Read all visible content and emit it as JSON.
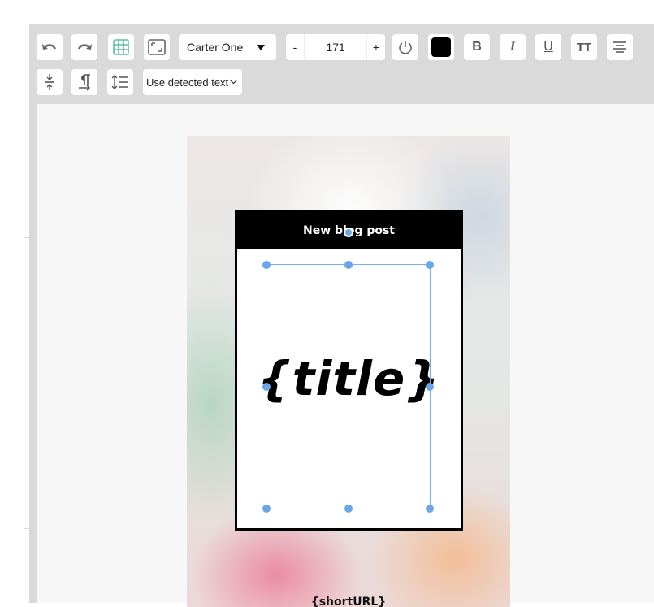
{
  "toolbar": {
    "font_family_value": "Carter One",
    "font_size_minus": "-",
    "font_size_value": "171",
    "font_size_plus": "+",
    "text_color": "#000000",
    "bold_label": "B",
    "italic_label": "I",
    "underline_label": "U",
    "text_case_label": "TT",
    "text_mode_value": "Use detected text"
  },
  "canvas": {
    "header_text": "New blog post",
    "title_text": "{title}",
    "footer_text": "{shortURL}"
  },
  "colors": {
    "toolbar_bg": "#dadada",
    "selection": "#6aa7ea",
    "grid_icon": "#5bc0a0"
  }
}
